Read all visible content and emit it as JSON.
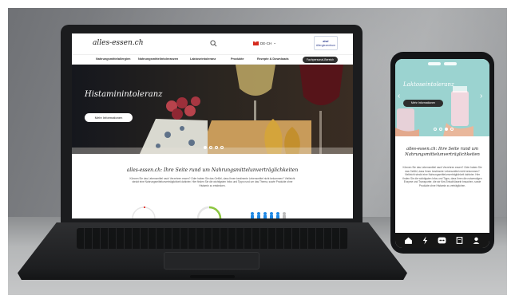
{
  "colors": {
    "laptop_frame": "#1b1c1e",
    "phone_hero_bg": "#9bd3d0",
    "dark_button": "#2f2f2f",
    "swiss_red": "#d52b1e",
    "accent_green": "#8cc63f",
    "accent_blue": "#1e88e5",
    "accent_red": "#e53935"
  },
  "site": {
    "logo": "alles-essen.ch",
    "language": "DE-CH",
    "language_flag": "swiss-flag-icon",
    "sponsor": {
      "line1": "aha!",
      "line2": "Allergiezentrum"
    },
    "nav": {
      "items": [
        "Nahrungsmittelallergien",
        "Nahrungsmittelintoleranzen",
        "Laktoseintoleranz",
        "Produkte",
        "Rezepte & Downloads"
      ],
      "cta": "Fachpersonal-Bereich"
    },
    "hero": {
      "title": "Histaminintoleranz",
      "button": "Mehr Informationen"
    },
    "intro": {
      "heading": "alles-essen.ch: Ihre Seite rund um Nahrungsmittelunverträglichkeiten",
      "text": "Können Sie das Lebensmittel nach Verzehren essen? Oder haben Sie das Gefühl, dass Ihnen bestimmte Lebensmittel nicht bekommen? Vielleicht steckt eine Nahrungsmittelunverträglichkeit dahinter. Hier finden Sie die wichtigsten Infos und Tipps rund um das Thema, sowie Produkte ohne Histamin zu entdecken."
    }
  },
  "mobile": {
    "hero": {
      "title": "Laktoseintoleranz",
      "button": "Mehr Informationen"
    },
    "intro": {
      "heading": "alles-essen.ch: Ihre Seite rund um Nahrungsmittelunverträglichkeiten",
      "text": "Können Sie das Lebensmittel nach Verzehren essen? Oder haben Sie das Gefühl, dass Ihnen bestimmte Lebensmittel nicht bekommen? Vielleicht steckt eine Nahrungsmittelunverträglichkeit dahinter. Hier finden Sie die wichtigsten Infos und Tipps, dass Ihren die notwendigen Enzyme und Transporter, die wir fürs Entschlüsseln brauchen, sowie Produkte ohne Histamin zu verträglichen."
    },
    "tabs": [
      "home-icon",
      "bolt-icon",
      "chat-icon",
      "book-icon",
      "profile-icon"
    ]
  }
}
